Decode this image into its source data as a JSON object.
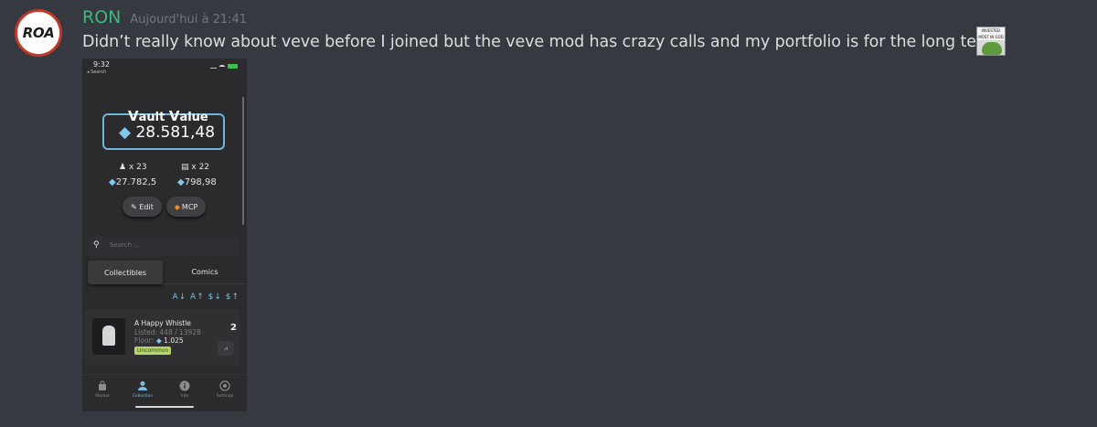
{
  "message": {
    "avatar_text": "ROA",
    "username": "RON",
    "timestamp": "Aujourd'hui à 21:41",
    "text": "Didn’t really know about veve before I joined but the veve mod has crazy calls and my portfolio is for the long term",
    "emote_text": "INVESTED MOST IN GOD",
    "username_color": "#43b581"
  },
  "phone": {
    "time": "9:32",
    "back_label": "◂ Search",
    "vault_title_v1": "V",
    "vault_title_w1": "ault",
    "vault_title_v2": "V",
    "vault_title_w2": "alue",
    "vault_value": "28.581,48",
    "collectibles_count": "x 23",
    "comics_count": "x 22",
    "collectibles_value": "27.782,5",
    "comics_value": "798,98",
    "edit_label": "Edit",
    "mcp_label": "MCP",
    "search_placeholder": "Search ...",
    "tabs": [
      "Collectibles",
      "Comics"
    ],
    "active_tab": "Collectibles",
    "sort_options": "A↓ A↑ $↓ $↑",
    "card": {
      "name": "A Happy Whistle",
      "listed": "Listed: 448 / 13928",
      "floor_label": "Floor:",
      "floor_value": "1.025",
      "rarity": "Uncommon",
      "quantity": "2"
    },
    "nav": [
      {
        "label": "Market",
        "icon": "bag-icon"
      },
      {
        "label": "Collection",
        "icon": "person-icon"
      },
      {
        "label": "Info",
        "icon": "info-icon"
      },
      {
        "label": "Settings",
        "icon": "gear-icon"
      }
    ],
    "active_nav": "Collection",
    "accent_color": "#79bde0"
  }
}
